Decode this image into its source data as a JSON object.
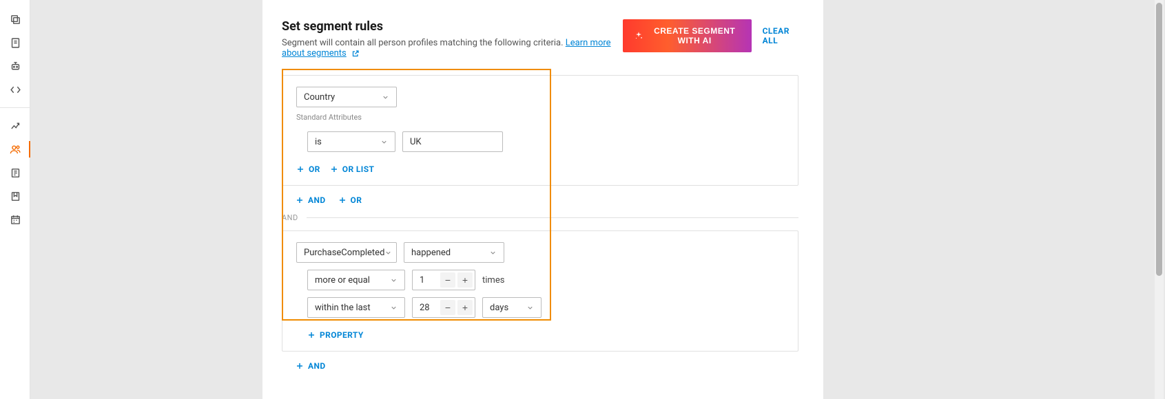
{
  "header": {
    "title": "Set segment rules",
    "subtitle_prefix": "Segment will contain all person profiles matching the following criteria.  ",
    "learn_more": "Learn more about segments",
    "create_ai": "CREATE SEGMENT WITH AI",
    "clear_all": "CLEAR ALL"
  },
  "rule1": {
    "attribute": "Country",
    "attribute_group": "Standard Attributes",
    "operator": "is",
    "value": "UK",
    "or": "OR",
    "or_list": "OR LIST"
  },
  "between": {
    "and": "AND",
    "or": "OR"
  },
  "connector": "AND",
  "rule2": {
    "event": "PurchaseCompleted",
    "occurrence": "happened",
    "compare": "more or equal",
    "count": "1",
    "times": "times",
    "within": "within the last",
    "period_value": "28",
    "period_unit": "days",
    "property": "PROPERTY"
  },
  "footer": {
    "and": "AND"
  }
}
